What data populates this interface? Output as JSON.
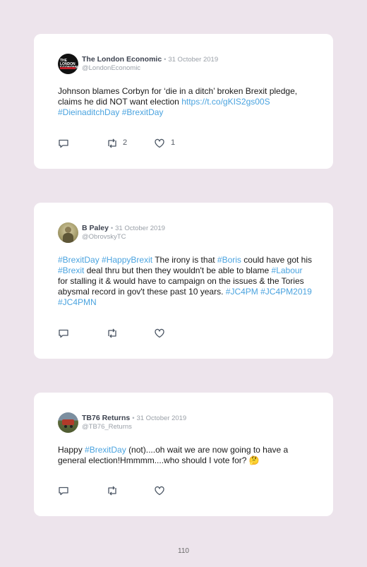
{
  "tweets": [
    {
      "name": "The London Economic",
      "separator": "•",
      "date": "31 October 2019",
      "handle": "@LondonEconomic",
      "avatar_text": "THE LONDON ECONOMIC",
      "text_plain": "Johnson blames Corbyn for ‘die in a ditch’ broken Brexit pledge, claims he did NOT want election",
      "link": "https://t.co/gKIS2gs00S",
      "tag1": "#DieinaditchDay",
      "tag2": "#BrexitDay",
      "retweets": "2",
      "likes": "1"
    },
    {
      "name": "B Paley",
      "separator": "•",
      "date": "31 October 2019",
      "handle": "@ObrovskyTC",
      "t1": "#BrexitDay",
      "t2": "#HappyBrexit",
      "s1": "The irony is that",
      "t3": "#Boris",
      "s2": "could have got his",
      "t4": "#Brexit",
      "s3": "deal thru but then they wouldn't be able to blame",
      "t5": "#Labour",
      "s4": "for stalling it & would have to campaign on the issues & the Tories abysmal record in gov't these past 10 years.",
      "t6": "#JC4PM",
      "t7": "#JC4PM2019",
      "t8": "#JC4PMN"
    },
    {
      "name": "TB76 Returns",
      "separator": "•",
      "date": "31 October 2019",
      "handle": "@TB76_Returns",
      "s1": "Happy",
      "t1": "#BrexitDay",
      "s2": "(not)....oh wait we are now going to have a general election!Hmmmm....who should I vote for?",
      "emoji": "🤔"
    }
  ],
  "page_number": "110",
  "colors": {
    "background": "#ede4ec",
    "card": "#ffffff",
    "link": "#4aa3df",
    "icon": "#4a5563"
  },
  "icons": [
    "reply-icon",
    "retweet-icon",
    "like-icon"
  ]
}
